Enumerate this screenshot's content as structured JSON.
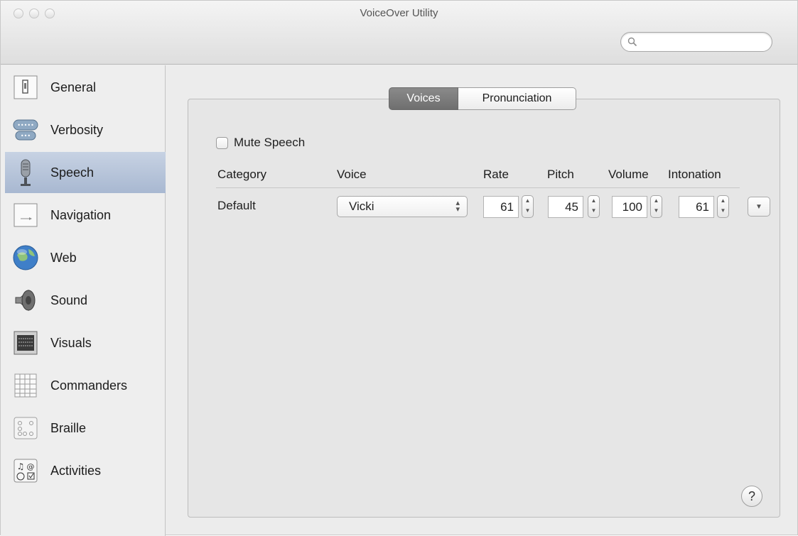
{
  "window": {
    "title": "VoiceOver Utility"
  },
  "search": {
    "placeholder": ""
  },
  "sidebar": {
    "items": [
      {
        "label": "General",
        "icon": "general-icon"
      },
      {
        "label": "Verbosity",
        "icon": "verbosity-icon"
      },
      {
        "label": "Speech",
        "icon": "microphone-icon",
        "selected": true
      },
      {
        "label": "Navigation",
        "icon": "navigation-icon"
      },
      {
        "label": "Web",
        "icon": "globe-icon"
      },
      {
        "label": "Sound",
        "icon": "speaker-icon"
      },
      {
        "label": "Visuals",
        "icon": "visuals-icon"
      },
      {
        "label": "Commanders",
        "icon": "grid-icon"
      },
      {
        "label": "Braille",
        "icon": "braille-icon"
      },
      {
        "label": "Activities",
        "icon": "activities-icon"
      }
    ]
  },
  "tabs": {
    "voices": "Voices",
    "pronunciation": "Pronunciation",
    "selected": "Voices"
  },
  "mute": {
    "label": "Mute Speech",
    "checked": false
  },
  "table": {
    "headers": {
      "category": "Category",
      "voice": "Voice",
      "rate": "Rate",
      "pitch": "Pitch",
      "volume": "Volume",
      "intonation": "Intonation"
    },
    "row": {
      "category": "Default",
      "voice": "Vicki",
      "rate": "61",
      "pitch": "45",
      "volume": "100",
      "intonation": "61"
    }
  },
  "help": {
    "label": "?"
  },
  "colors": {
    "selected_row": "#b3c1d8",
    "active_tab": "#7d7d7d"
  }
}
